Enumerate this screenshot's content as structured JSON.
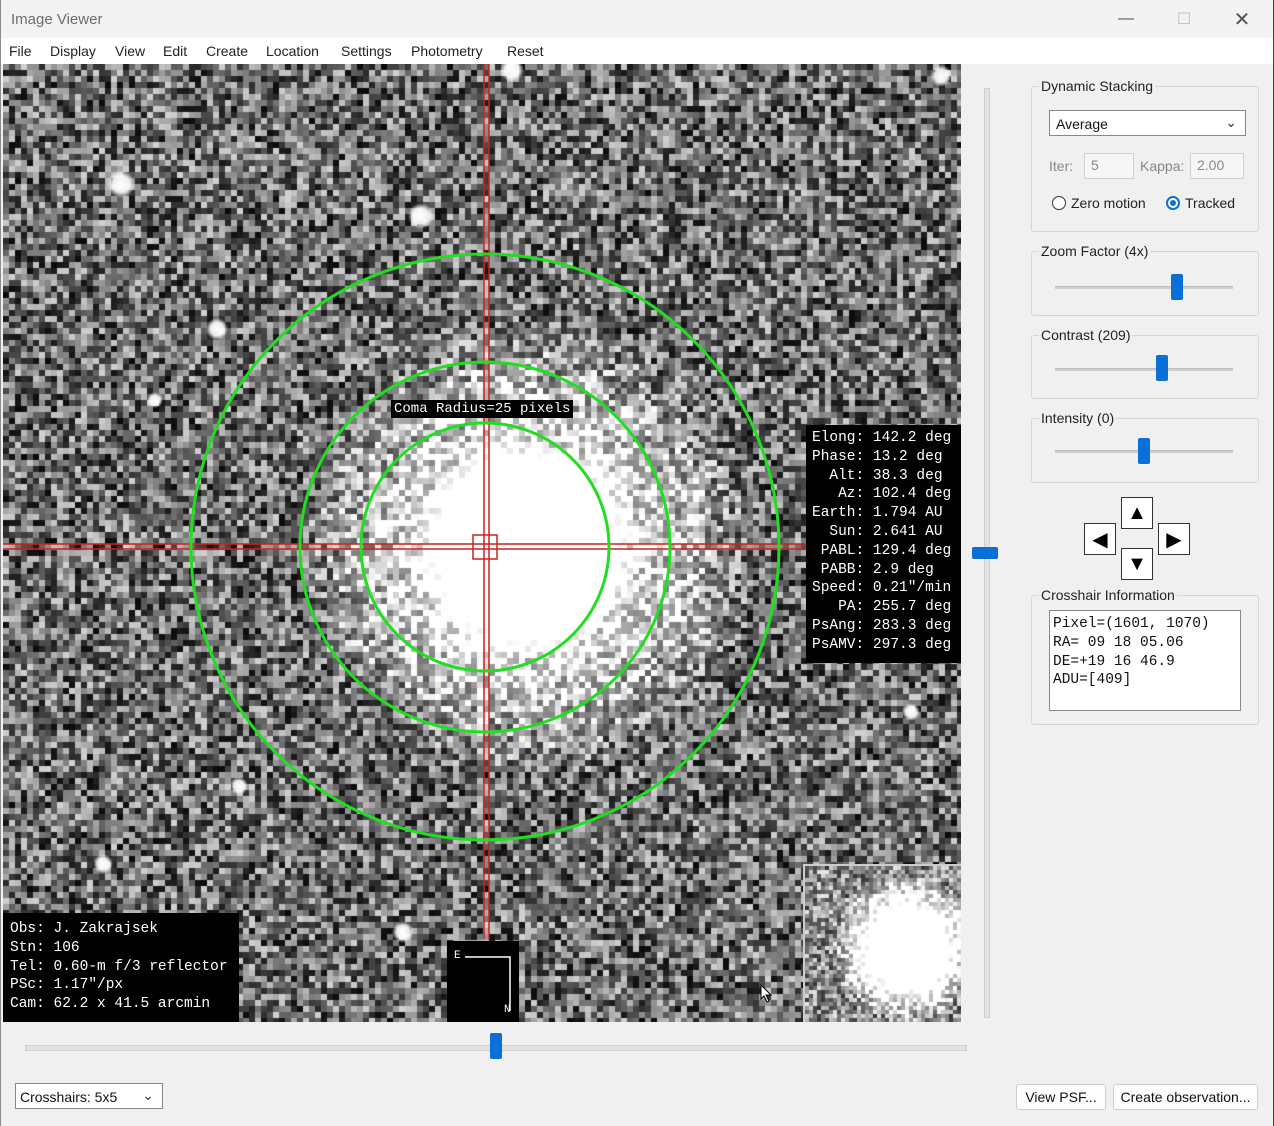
{
  "window": {
    "title": "Image Viewer"
  },
  "menu": [
    {
      "label": "File"
    },
    {
      "label": "Display"
    },
    {
      "label": "View"
    },
    {
      "label": "Edit"
    },
    {
      "label": "Create"
    },
    {
      "label": "Location"
    },
    {
      "label": "Settings"
    },
    {
      "label": "Photometry"
    },
    {
      "label": "Reset"
    }
  ],
  "image": {
    "coma_label": "Coma Radius=25 pixels",
    "ephemeris": "Elong: 142.2 deg\nPhase: 13.2 deg\n  Alt: 38.3 deg\n   Az: 102.4 deg\nEarth: 1.794 AU\n  Sun: 2.641 AU\n PABL: 129.4 deg\n PABB: 2.9 deg\nSpeed: 0.21\"/min\n   PA: 255.7 deg\nPsAng: 283.3 deg\nPsAMV: 297.3 deg",
    "observer": "Obs: J. Zakrajsek\nStn: 106\nTel: 0.60-m f/3 reflector\nPSc: 1.17\"/px\nCam: 62.2 x 41.5 arcmin",
    "compass_e": "E",
    "compass_n": "N",
    "ring_color": "#22dd22",
    "crosshair_color": "#cc2020"
  },
  "panel": {
    "stacking": {
      "label": "Dynamic Stacking",
      "method": "Average",
      "iter_label": "Iter:",
      "iter_value": "5",
      "kappa_label": "Kappa:",
      "kappa_value": "2.00",
      "zero_motion_label": "Zero motion",
      "tracked_label": "Tracked",
      "selected": "Tracked"
    },
    "zoom": {
      "label": "Zoom Factor (4x)",
      "value": 4
    },
    "contrast": {
      "label": "Contrast (209)",
      "value": 209
    },
    "intensity": {
      "label": "Intensity (0)",
      "value": 0
    },
    "arrows": {
      "up": "▲",
      "down": "▼",
      "left": "◀",
      "right": "▶"
    },
    "crosshair_info": {
      "label": "Crosshair Information",
      "text": "Pixel=(1601, 1070)\nRA= 09 18 05.06\nDE=+19 16 46.9\nADU=[409]"
    }
  },
  "footer": {
    "crosshairs_select": "Crosshairs: 5x5",
    "view_psf": "View PSF...",
    "create_observation": "Create observation..."
  },
  "accent": "#0a6fd6"
}
